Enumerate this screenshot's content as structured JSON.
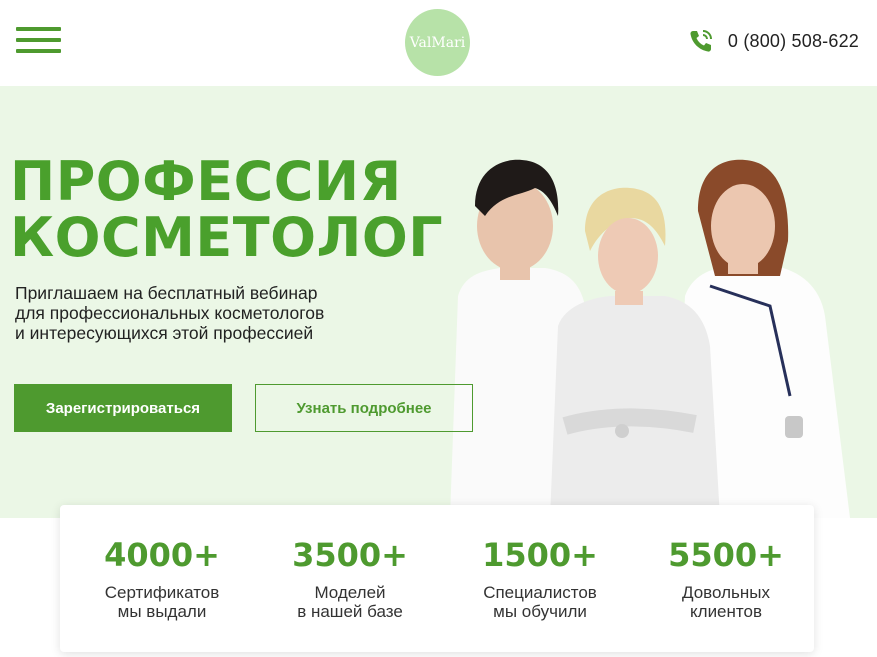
{
  "header": {
    "logo_text": "ValMari",
    "phone": "0 (800) 508-622",
    "icons": {
      "menu": "hamburger-menu-icon",
      "phone": "phone-ringing-icon"
    }
  },
  "hero": {
    "title_line1": "ПРОФЕССИЯ",
    "title_line2": "КОСМЕТОЛОГ",
    "subtitle_line1": "Приглашаем на бесплатный вебинар",
    "subtitle_line2": "для профессиональных косметологов",
    "subtitle_line3": "и интересующихся этой профессией",
    "register_label": "Зарегистрироваться",
    "more_label": "Узнать подробнее"
  },
  "stats": [
    {
      "value": "4000+",
      "line1": "Сертификатов",
      "line2": "мы выдали"
    },
    {
      "value": "3500+",
      "line1": "Моделей",
      "line2": "в нашей базе"
    },
    {
      "value": "1500+",
      "line1": "Специалистов",
      "line2": "мы обучили"
    },
    {
      "value": "5500+",
      "line1": "Довольных",
      "line2": "клиентов"
    }
  ],
  "colors": {
    "brand_green": "#4e9a2f",
    "hero_bg": "#ebf7e6",
    "logo_bg": "#b7e2a8"
  }
}
